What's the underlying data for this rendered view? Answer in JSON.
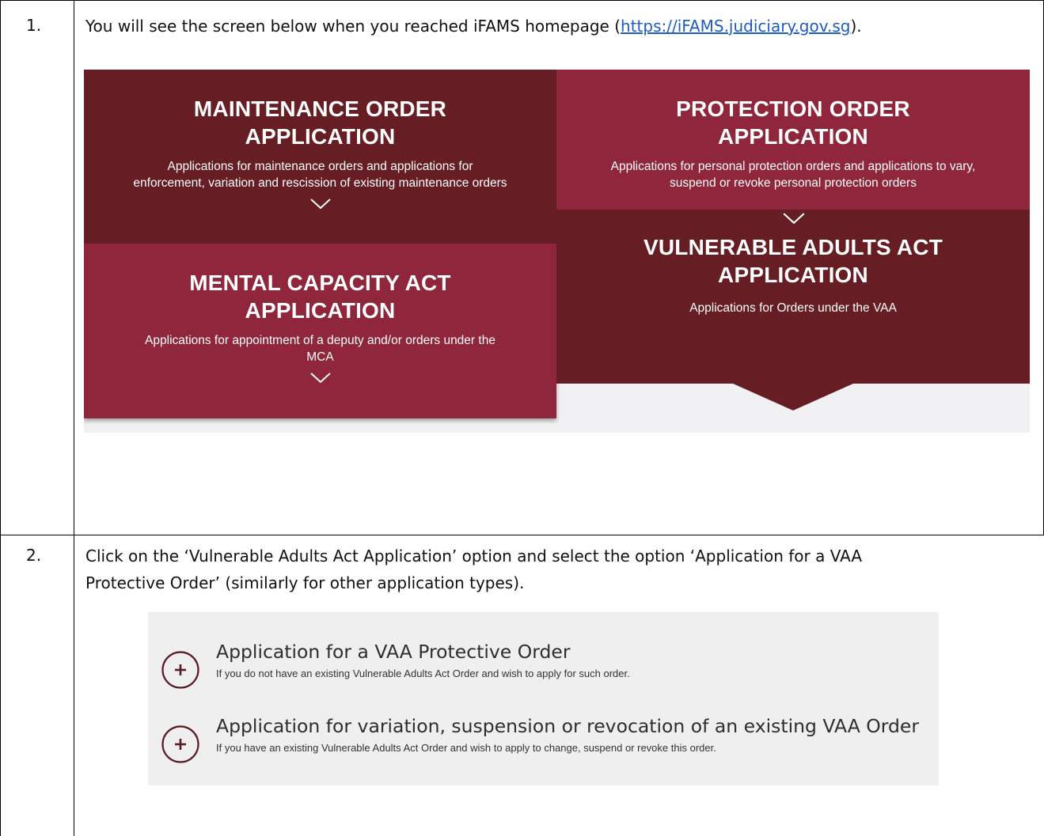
{
  "steps": [
    {
      "number": "1.",
      "text_before": "You will see the screen below when you reached iFAMS homepage (",
      "link": "https://iFAMS.judiciary.gov.sg",
      "text_after": ")."
    },
    {
      "number": "2.",
      "line1": "Click on the ‘Vulnerable Adults Act Application’ option and select the option ‘Application for a VAA",
      "line2": "Protective Order’ (similarly for other application types)."
    }
  ],
  "homepage": {
    "maintenance": {
      "title_line1": "MAINTENANCE ORDER",
      "title_line2": "APPLICATION",
      "desc_line1": "Applications for maintenance orders and applications for",
      "desc_line2": "enforcement, variation and rescission of existing maintenance orders"
    },
    "protection": {
      "title_line1": "PROTECTION ORDER",
      "title_line2": "APPLICATION",
      "desc_line1": "Applications for personal protection orders and applications to vary,",
      "desc_line2": "suspend or revoke personal protection orders"
    },
    "mental": {
      "title_line1": "MENTAL CAPACITY ACT",
      "title_line2": "APPLICATION",
      "desc_line1": "Applications for appointment of a deputy and/or orders under the",
      "desc_line2": "MCA"
    },
    "vaa": {
      "title_line1": "VULNERABLE ADULTS ACT",
      "title_line2": "APPLICATION",
      "desc_line1": "Applications for Orders under the VAA"
    },
    "colors": {
      "dark": "#661d23",
      "red": "#8f263b"
    },
    "icons": {
      "expand": "chevron-down-icon"
    }
  },
  "vaa_options": [
    {
      "title": "Application for a VAA Protective Order",
      "desc": "If you do not have an existing Vulnerable Adults Act Order and wish to apply for such order.",
      "icon": "plus-circle-icon"
    },
    {
      "title": "Application for variation, suspension or revocation of an existing VAA Order",
      "desc": "If you have an existing Vulnerable Adults Act Order and wish to apply to change, suspend or revoke this order.",
      "icon": "plus-circle-icon"
    }
  ]
}
